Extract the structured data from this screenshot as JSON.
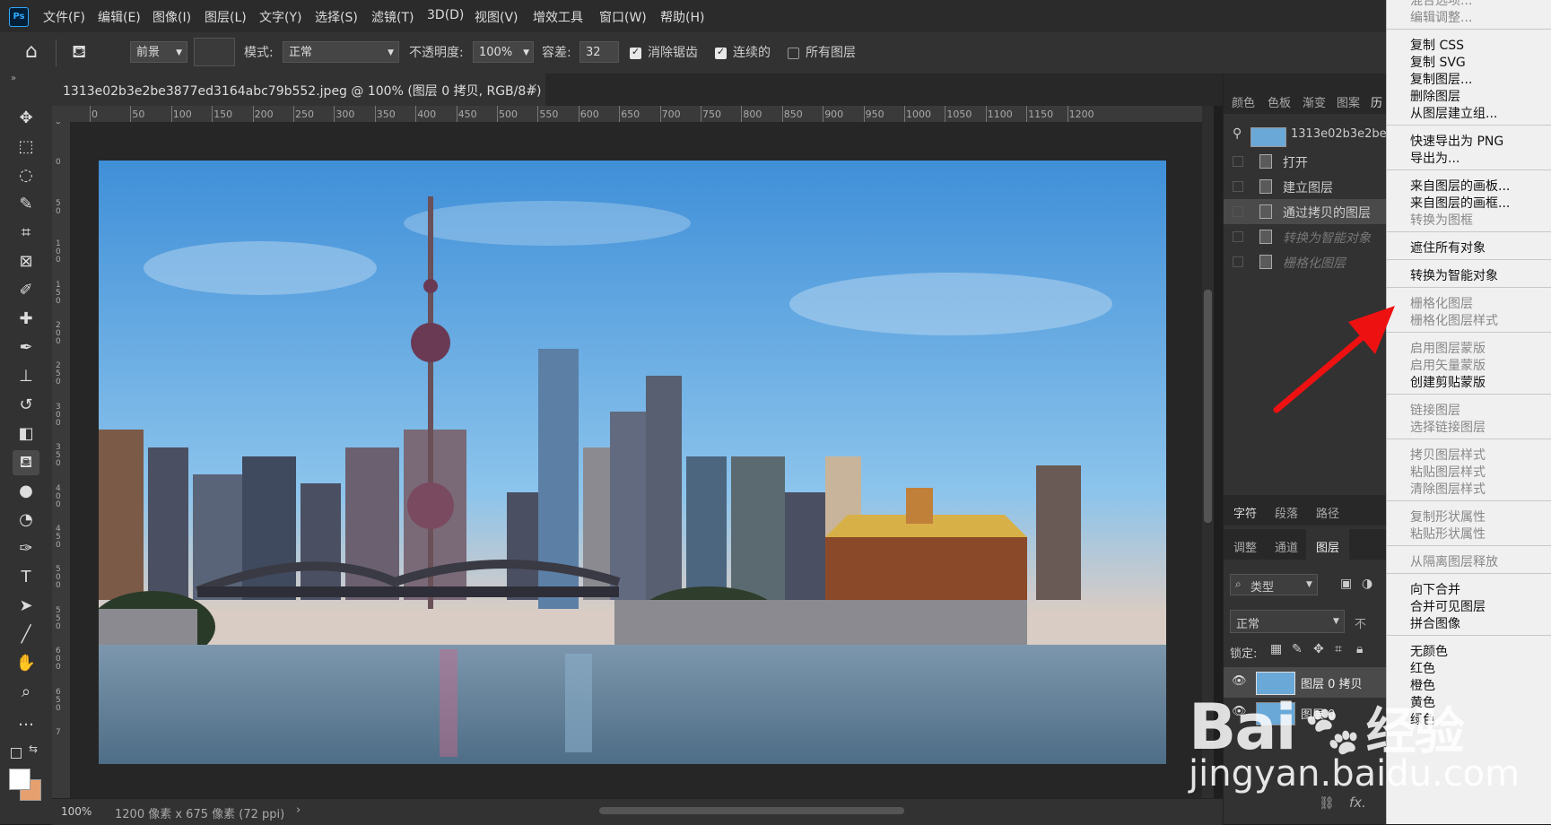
{
  "app": {
    "logo": "Ps"
  },
  "menubar": {
    "items": [
      "文件(F)",
      "编辑(E)",
      "图像(I)",
      "图层(L)",
      "文字(Y)",
      "选择(S)",
      "滤镜(T)",
      "3D(D)",
      "视图(V)",
      "增效工具",
      "窗口(W)",
      "帮助(H)"
    ]
  },
  "options": {
    "fill_source": "前景",
    "mode_label": "模式:",
    "mode_value": "正常",
    "opacity_label": "不透明度:",
    "opacity_value": "100%",
    "tolerance_label": "容差:",
    "tolerance_value": "32",
    "antialias_label": "消除锯齿",
    "contiguous_label": "连续的",
    "all_layers_label": "所有图层"
  },
  "document": {
    "tab_title": "1313e02b3e2be3877ed3164abc79b552.jpeg @ 100% (图层 0 拷贝, RGB/8#) *",
    "ruler_top": [
      "0",
      "50",
      "100",
      "150",
      "200",
      "250",
      "300",
      "350",
      "400",
      "450",
      "500",
      "550",
      "600",
      "650",
      "700",
      "750",
      "800",
      "850",
      "900",
      "950",
      "1000",
      "1050",
      "1100",
      "1150",
      "1200"
    ],
    "ruler_left": [
      "0",
      "0",
      "5 0",
      "1 0 0",
      "1 5 0",
      "2 0 0",
      "2 5 0",
      "3 0 0",
      "3 5 0",
      "4 0 0",
      "4 5 0",
      "5 0 0",
      "5 5 0",
      "6 0 0",
      "6 5 0",
      "7"
    ]
  },
  "status": {
    "zoom": "100%",
    "doc_info": "1200 像素 x 675 像素 (72 ppi)"
  },
  "panels": {
    "top_tabs": [
      "颜色",
      "色板",
      "渐变",
      "图案",
      "历"
    ],
    "snapshot_name": "1313e02b3e2be",
    "history": [
      "打开",
      "建立图层",
      "通过拷贝的图层",
      "转换为智能对象",
      "栅格化图层"
    ],
    "mid_tabs": [
      "字符",
      "段落",
      "路径"
    ],
    "layer_tabs": [
      "调整",
      "通道",
      "图层"
    ],
    "filter_type": "类型",
    "blend_mode": "正常",
    "opacity_short": "不",
    "lock_label": "锁定:",
    "layers": [
      "图层 0 拷贝",
      "图层 0"
    ],
    "fx_label": "fx."
  },
  "context_menu": {
    "groups": [
      [
        {
          "label": "混合选项...",
          "enabled": false
        },
        {
          "label": "编辑调整...",
          "enabled": false
        }
      ],
      [
        {
          "label": "复制 CSS",
          "enabled": true
        },
        {
          "label": "复制 SVG",
          "enabled": true
        },
        {
          "label": "复制图层...",
          "enabled": true
        },
        {
          "label": "删除图层",
          "enabled": true
        },
        {
          "label": "从图层建立组...",
          "enabled": true
        }
      ],
      [
        {
          "label": "快速导出为 PNG",
          "enabled": true
        },
        {
          "label": "导出为...",
          "enabled": true
        }
      ],
      [
        {
          "label": "来自图层的画板...",
          "enabled": true
        },
        {
          "label": "来自图层的画框...",
          "enabled": true
        },
        {
          "label": "转换为图框",
          "enabled": false
        }
      ],
      [
        {
          "label": "遮住所有对象",
          "enabled": true
        }
      ],
      [
        {
          "label": "转换为智能对象",
          "enabled": true
        }
      ],
      [
        {
          "label": "栅格化图层",
          "enabled": false
        },
        {
          "label": "栅格化图层样式",
          "enabled": false
        }
      ],
      [
        {
          "label": "启用图层蒙版",
          "enabled": false
        },
        {
          "label": "启用矢量蒙版",
          "enabled": false
        },
        {
          "label": "创建剪贴蒙版",
          "enabled": true
        }
      ],
      [
        {
          "label": "链接图层",
          "enabled": false
        },
        {
          "label": "选择链接图层",
          "enabled": false
        }
      ],
      [
        {
          "label": "拷贝图层样式",
          "enabled": false
        },
        {
          "label": "粘贴图层样式",
          "enabled": false
        },
        {
          "label": "清除图层样式",
          "enabled": false
        }
      ],
      [
        {
          "label": "复制形状属性",
          "enabled": false
        },
        {
          "label": "粘贴形状属性",
          "enabled": false
        }
      ],
      [
        {
          "label": "从隔离图层释放",
          "enabled": false
        }
      ],
      [
        {
          "label": "向下合并",
          "enabled": true
        },
        {
          "label": "合并可见图层",
          "enabled": true
        },
        {
          "label": "拼合图像",
          "enabled": true
        }
      ],
      [
        {
          "label": "无颜色",
          "enabled": true
        },
        {
          "label": "红色",
          "enabled": true
        },
        {
          "label": "橙色",
          "enabled": true
        },
        {
          "label": "黄色",
          "enabled": true
        },
        {
          "label": "绿色",
          "enabled": true
        }
      ]
    ]
  },
  "watermark": {
    "line1": "Bai",
    "line1b": "经验",
    "line2": "jingyan.baidu.com"
  },
  "colors": {
    "accent": "#31a8ff",
    "arrow": "#ee1111",
    "menu_bg": "#f0f0f0"
  }
}
